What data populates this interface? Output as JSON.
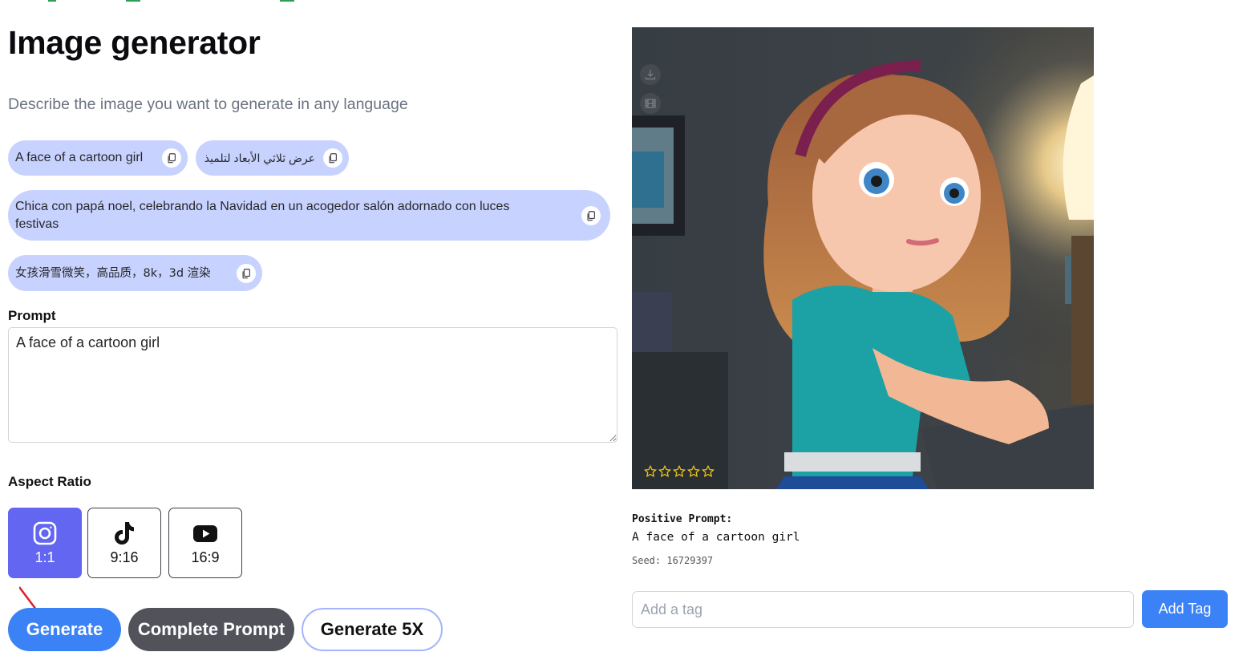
{
  "header": {
    "title": "Image generator",
    "subtitle": "Describe the image you want to generate in any language"
  },
  "examples": [
    {
      "text": "A face of a cartoon girl",
      "copy_icon": "copy-icon"
    },
    {
      "text": "عرض ثلاثي الأبعاد لتلميذ",
      "copy_icon": "copy-icon"
    },
    {
      "text": "Chica con papá noel, celebrando la Navidad en un acogedor salón adornado con luces festivas",
      "copy_icon": "copy-icon"
    },
    {
      "text": "女孩滑雪微笑，高品质，8k，3d 渲染",
      "copy_icon": "copy-icon"
    }
  ],
  "prompt": {
    "label": "Prompt",
    "value": "A face of a cartoon girl"
  },
  "aspect_ratio": {
    "label": "Aspect Ratio",
    "options": [
      {
        "label": "1:1",
        "icon": "instagram-icon",
        "selected": true
      },
      {
        "label": "9:16",
        "icon": "tiktok-icon",
        "selected": false
      },
      {
        "label": "16:9",
        "icon": "youtube-icon",
        "selected": false
      }
    ]
  },
  "actions": {
    "generate": "Generate",
    "complete_prompt": "Complete Prompt",
    "generate_5x": "Generate 5X"
  },
  "result": {
    "image_alt": "Cartoon girl with brown hair and headband leaning on a desk by a lamp",
    "image_actions": [
      "download-icon",
      "film-icon"
    ],
    "rating": {
      "value": 0,
      "max": 5
    },
    "positive_prompt_label": "Positive Prompt:",
    "positive_prompt": "A face of a cartoon girl",
    "seed": "Seed: 16729397"
  },
  "tags": {
    "placeholder": "Add a tag",
    "value": "",
    "add_label": "Add Tag"
  },
  "colors": {
    "chip_bg": "#c7d2fe",
    "selected_ratio": "#6366f1",
    "primary": "#3b82f6",
    "secondary": "#52525b",
    "outline": "#a5b4fc",
    "star": "#facc15"
  }
}
